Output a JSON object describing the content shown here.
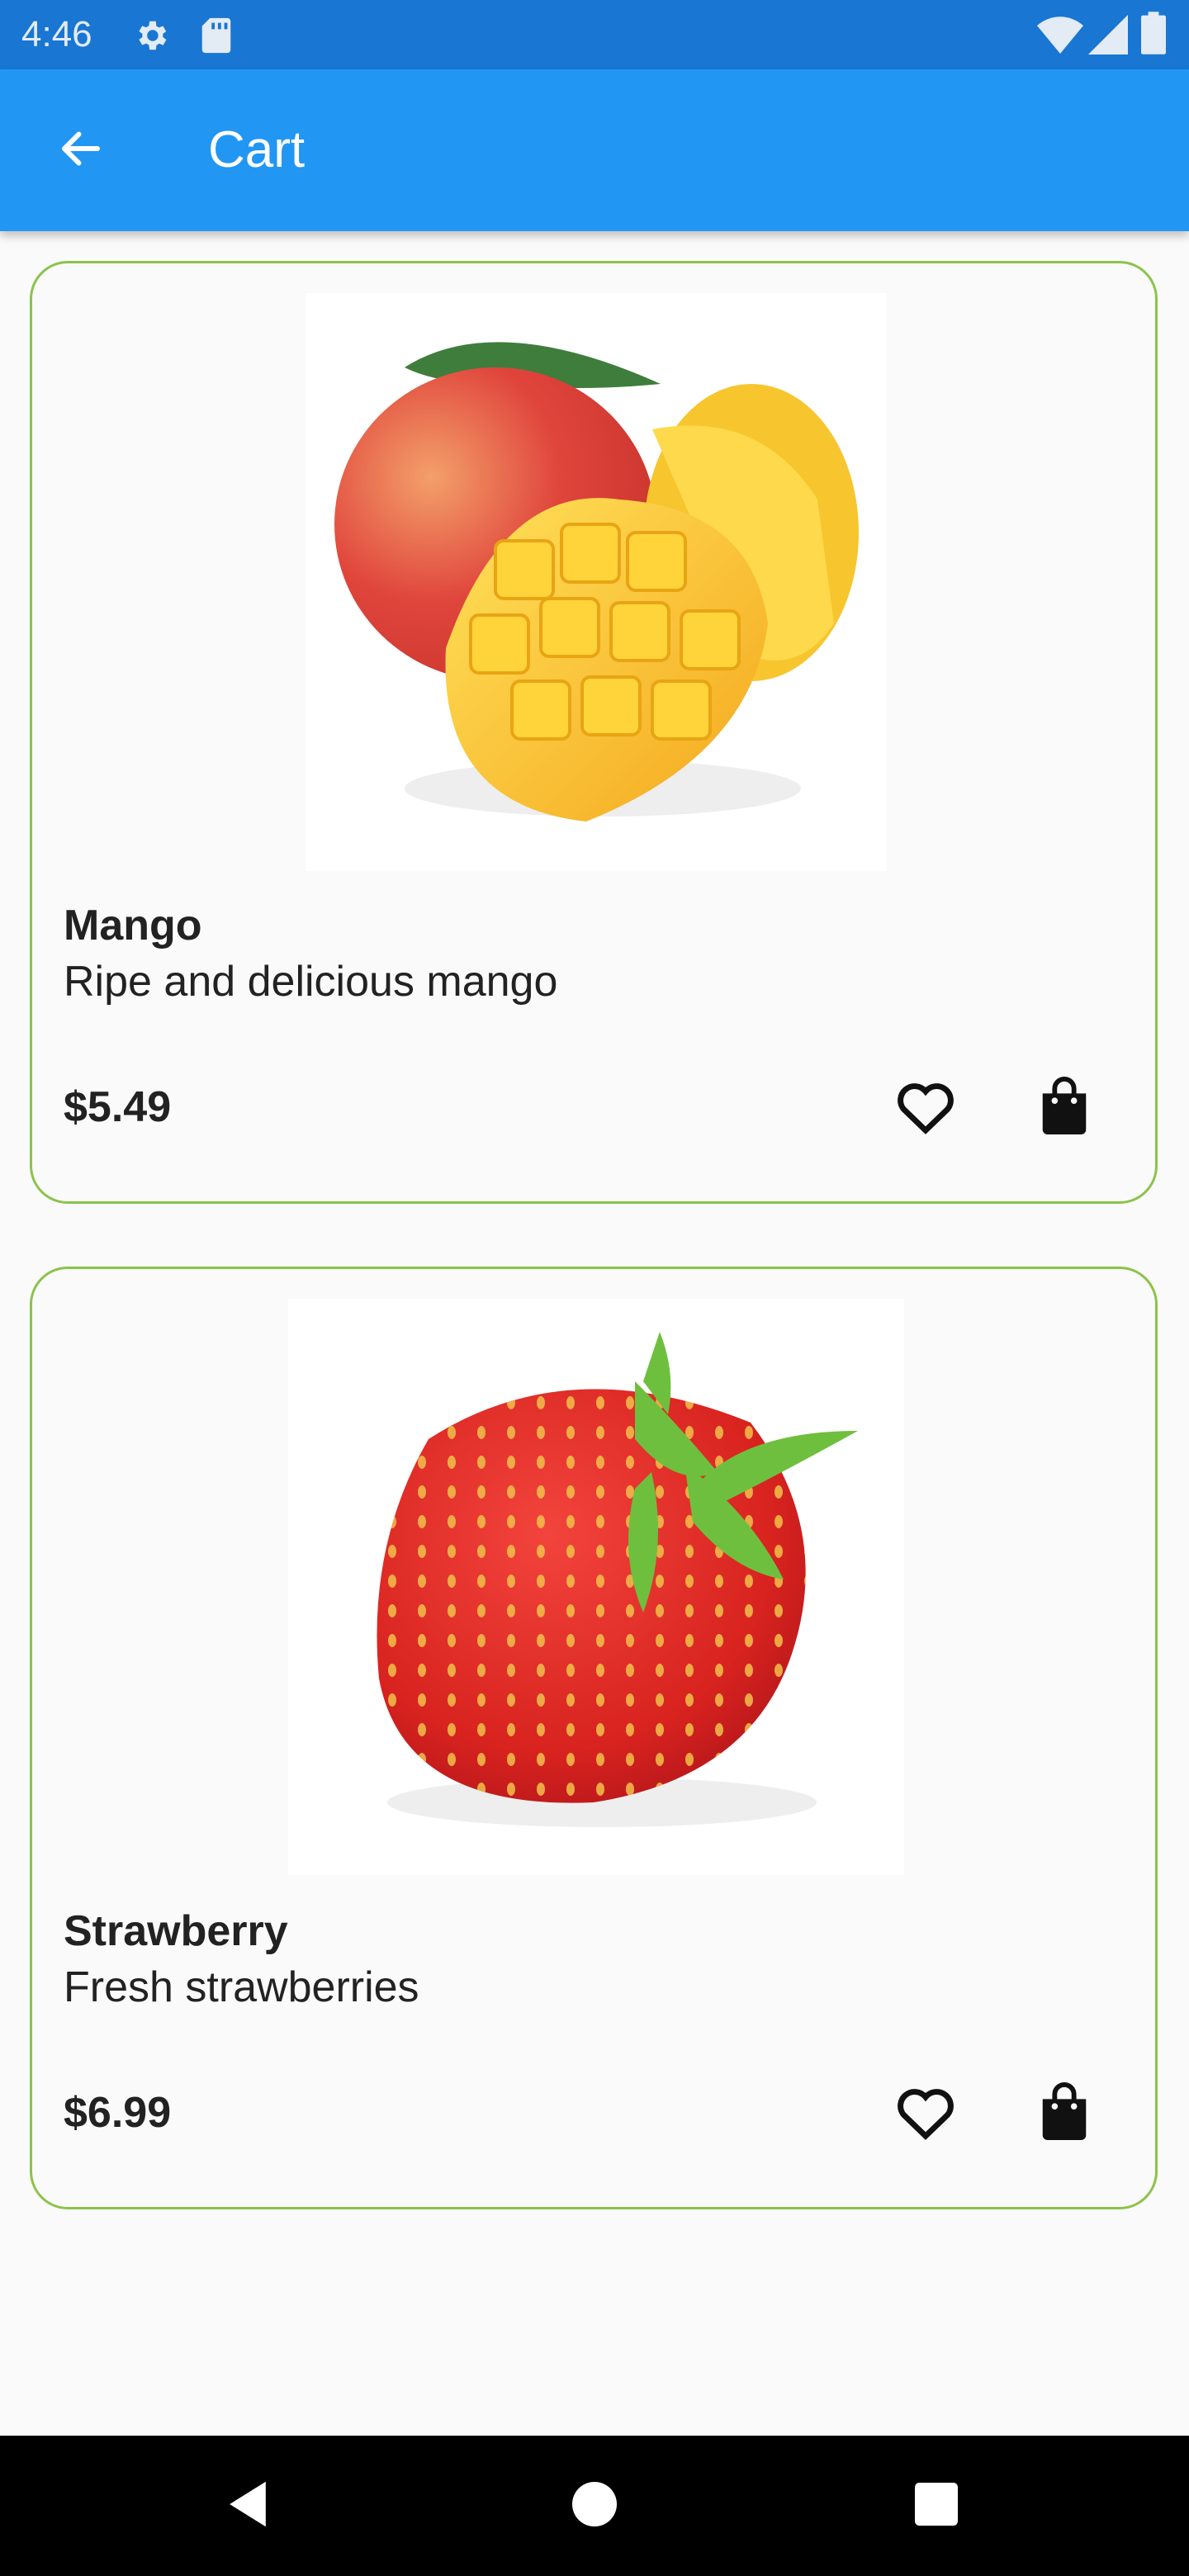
{
  "status_bar": {
    "time": "4:46",
    "icons": [
      "gear-icon",
      "sd-card-icon",
      "wifi-icon",
      "signal-icon",
      "battery-icon"
    ]
  },
  "app_bar": {
    "title": "Cart",
    "back_icon": "arrow-back-icon",
    "color": "#2196f3"
  },
  "products": [
    {
      "name": "Mango",
      "description": "Ripe and delicious mango",
      "price": "$5.49",
      "image": "mango-image",
      "favorite_icon": "heart-outline-icon",
      "cart_icon": "shopping-bag-icon"
    },
    {
      "name": "Strawberry",
      "description": "Fresh strawberries",
      "price": "$6.99",
      "image": "strawberry-image",
      "favorite_icon": "heart-outline-icon",
      "cart_icon": "shopping-bag-icon"
    }
  ],
  "colors": {
    "card_border": "#8bc34a",
    "status_bar": "#1976d2",
    "background": "#fafafa"
  },
  "nav_bar": {
    "icons": [
      "back-triangle-icon",
      "home-circle-icon",
      "recents-square-icon"
    ]
  }
}
